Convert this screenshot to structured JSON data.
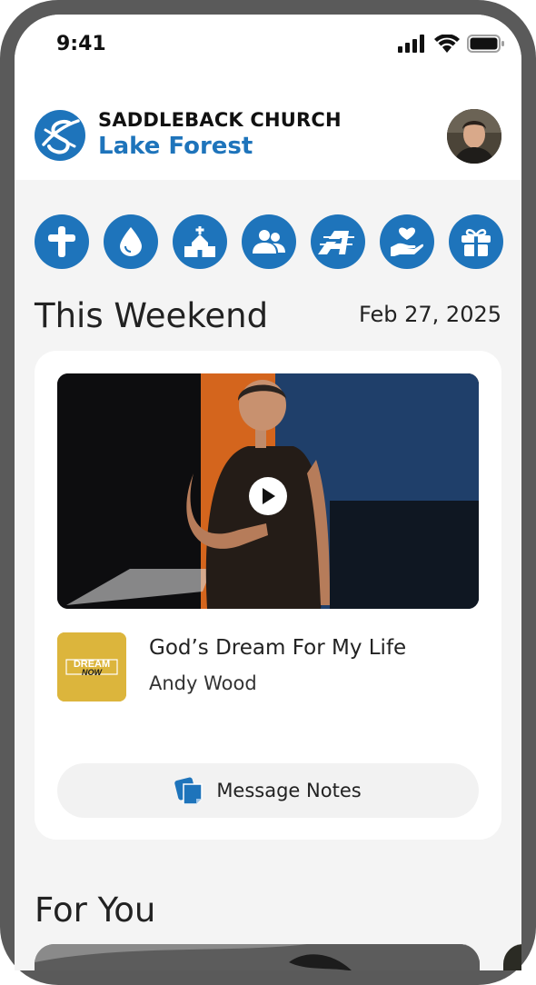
{
  "status_bar": {
    "time": "9:41",
    "icons": [
      "cellular-signal-icon",
      "wifi-icon",
      "battery-icon"
    ]
  },
  "header": {
    "church_name": "SADDLEBACK CHURCH",
    "campus_name": "Lake Forest",
    "logo_icon": "saddleback-logo",
    "avatar": "user-avatar"
  },
  "quick_actions": [
    {
      "icon": "cross-icon"
    },
    {
      "icon": "water-drop-icon"
    },
    {
      "icon": "church-icon"
    },
    {
      "icon": "group-icon"
    },
    {
      "icon": "stripe-a-icon"
    },
    {
      "icon": "heart-hand-icon"
    },
    {
      "icon": "gift-icon"
    }
  ],
  "this_weekend": {
    "title": "This Weekend",
    "date": "Feb 27, 2025",
    "video": {
      "play_icon": "play-icon"
    },
    "series_art": "DREAM NOW",
    "sermon_title": "God’s Dream For My Life",
    "speaker": "Andy Wood",
    "notes_button": {
      "label": "Message Notes",
      "icon": "notes-icon"
    }
  },
  "for_you": {
    "title": "For You"
  },
  "colors": {
    "brand_blue": "#1e74bb",
    "background": "#f4f4f4",
    "card": "#ffffff"
  }
}
